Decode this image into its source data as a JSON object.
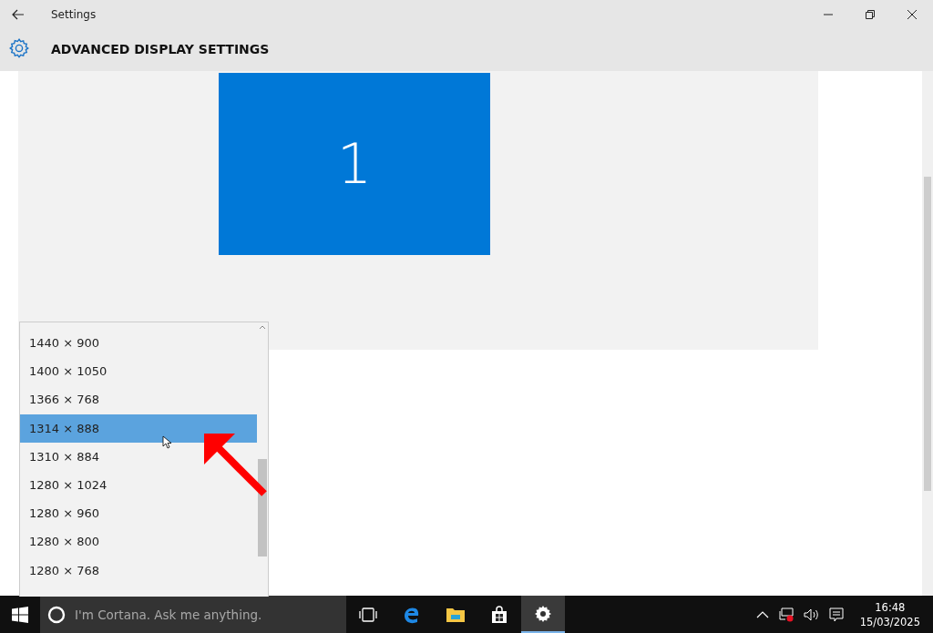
{
  "window": {
    "title": "Settings",
    "page_title": "ADVANCED DISPLAY SETTINGS"
  },
  "display_preview": {
    "monitor_label": "1"
  },
  "resolution_dropdown": {
    "items": [
      {
        "label": "1440 × 900",
        "selected": false
      },
      {
        "label": "1400 × 1050",
        "selected": false
      },
      {
        "label": "1366 × 768",
        "selected": false
      },
      {
        "label": "1314 × 888",
        "selected": true
      },
      {
        "label": "1310 × 884",
        "selected": false
      },
      {
        "label": "1280 × 1024",
        "selected": false
      },
      {
        "label": "1280 × 960",
        "selected": false
      },
      {
        "label": "1280 × 800",
        "selected": false
      },
      {
        "label": "1280 × 768",
        "selected": false
      }
    ]
  },
  "taskbar": {
    "search_placeholder": "I'm Cortana. Ask me anything.",
    "apps": [
      {
        "kind": "taskview",
        "selected": false
      },
      {
        "kind": "edge",
        "selected": false
      },
      {
        "kind": "explorer",
        "selected": false
      },
      {
        "kind": "store",
        "selected": false
      },
      {
        "kind": "settings",
        "selected": true
      }
    ],
    "time": "16:48",
    "date": "15/03/2025"
  }
}
